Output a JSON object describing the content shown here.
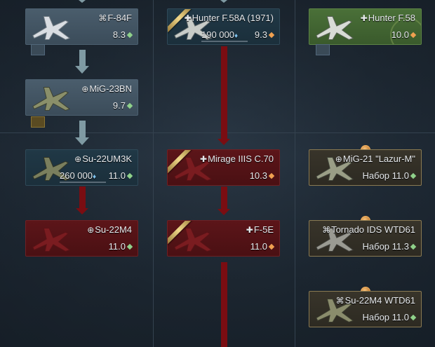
{
  "columns": [
    {
      "cards": [
        {
          "name": "F-84F",
          "flag": "⌘",
          "br": "8.3",
          "br_color": "#8fd18a",
          "state": "researched"
        },
        {
          "name": "MiG-23BN",
          "flag": "⊕",
          "br": "9.7",
          "br_color": "#8fd18a",
          "state": "researched"
        },
        {
          "name": "Su-22UM3K",
          "flag": "⊕",
          "br": "11.0",
          "br_color": "#8fd18a",
          "state": "locked",
          "cost": "260 000"
        },
        {
          "name": "Su-22M4",
          "flag": "⊕",
          "br": "11.0",
          "br_color": "#8fd18a",
          "state": "red"
        }
      ]
    },
    {
      "cards": [
        {
          "name": "Hunter F.58A (1971)",
          "flag": "✚",
          "br": "9.3",
          "br_color": "#f0a050",
          "state": "locked",
          "cost": "190 000"
        },
        {
          "name": "Mirage IIIS C.70",
          "flag": "✚",
          "br": "10.3",
          "br_color": "#f0a050",
          "state": "red"
        },
        {
          "name": "F-5E",
          "flag": "✚",
          "br": "11.0",
          "br_color": "#f0a050",
          "state": "red"
        }
      ]
    },
    {
      "cards": [
        {
          "name": "Hunter F.58",
          "flag": "✚",
          "br": "10.0",
          "br_color": "#f0a050",
          "state": "green"
        },
        {
          "name": "MiG-21 \"Lazur-M\"",
          "flag": "⊕",
          "br": "Набор 11.0",
          "br_color": "#8fd18a",
          "state": "event"
        },
        {
          "name": "Tornado IDS WTD61",
          "flag": "⌘",
          "br": "Набор 11.3",
          "br_color": "#8fd18a",
          "state": "event"
        },
        {
          "name": "Su-22M4 WTD61",
          "flag": "⌘",
          "br": "Набор 11.0",
          "br_color": "#8fd18a",
          "state": "event"
        }
      ]
    }
  ],
  "icons": {
    "rp": "research-points-icon",
    "diamond": "battle-rating-icon"
  }
}
